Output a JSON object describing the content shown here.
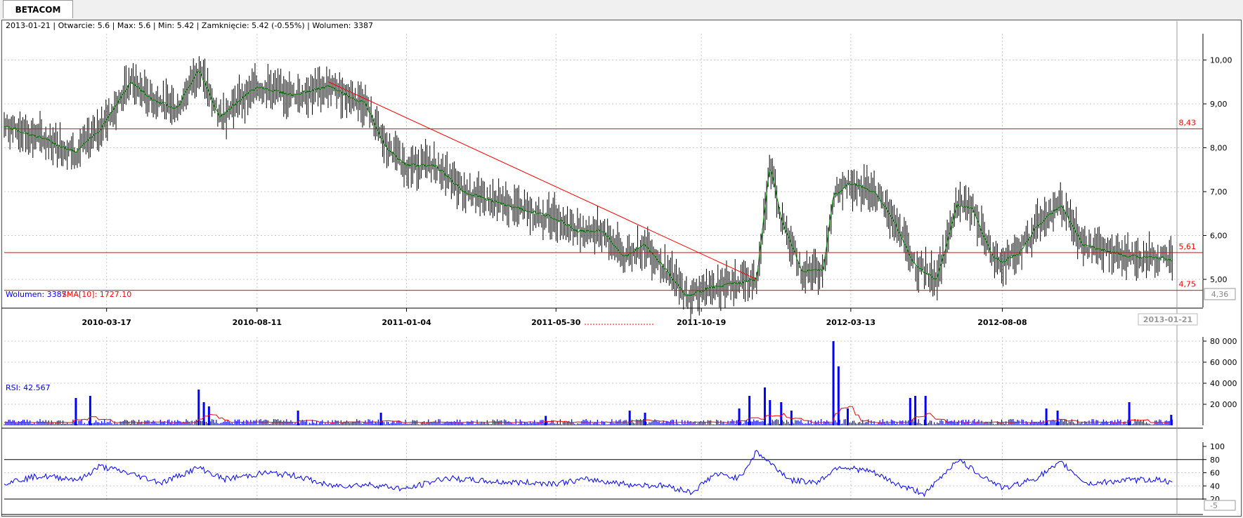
{
  "window": {
    "tab_label": "BETACOM"
  },
  "info": {
    "ohlc": "2013-01-21 | Otwarcie: 5.6 | Max: 5.6 | Min: 5.42 | Zamknięcie: 5.42 (-0.55%)  | Wolumen: 3387",
    "volume_label": "Wolumen: 3387",
    "sma_label": "SMA[10]: 1727.10",
    "rsi_label": "RSI: 42.567"
  },
  "colors": {
    "price_bar": "#000000",
    "sma_price": "#008000",
    "level": "#ff0000",
    "volume": "#0000ff",
    "rsi": "#0000ff",
    "grid": "#c8c8c8"
  },
  "chart_data": [
    {
      "type": "bar",
      "panel": "price",
      "y_ticks": [
        "10,00",
        "9,00",
        "8,00",
        "7,00",
        "6,00",
        "5,00"
      ],
      "ylim": [
        4.36,
        10.6
      ],
      "x_ticks": [
        "2010-03-17",
        "2010-08-11",
        "2011-01-04",
        "2011-05-30",
        "2011-10-19",
        "2012-03-13",
        "2012-08-08"
      ],
      "cursor_date": "2013-01-21",
      "cursor_price": "4,36",
      "levels": [
        {
          "value": 8.43,
          "label": "8,43"
        },
        {
          "value": 5.61,
          "label": "5,61"
        },
        {
          "value": 4.75,
          "label": "4,75"
        }
      ],
      "trendline": [
        {
          "date": "2010-10-20",
          "price": 9.5
        },
        {
          "date": "2011-12-12",
          "price": 5.0
        }
      ],
      "price_path": [
        [
          "2009-12-07",
          8.5
        ],
        [
          "2010-01-15",
          8.2
        ],
        [
          "2010-02-15",
          7.9
        ],
        [
          "2010-03-10",
          8.4
        ],
        [
          "2010-04-10",
          9.5
        ],
        [
          "2010-05-01",
          9.1
        ],
        [
          "2010-05-25",
          8.9
        ],
        [
          "2010-06-15",
          9.8
        ],
        [
          "2010-07-05",
          8.7
        ],
        [
          "2010-08-11",
          9.4
        ],
        [
          "2010-09-15",
          9.2
        ],
        [
          "2010-10-20",
          9.4
        ],
        [
          "2010-11-25",
          9.0
        ],
        [
          "2010-12-15",
          8.0
        ],
        [
          "2011-01-04",
          7.6
        ],
        [
          "2011-02-01",
          7.6
        ],
        [
          "2011-03-01",
          7.0
        ],
        [
          "2011-04-10",
          6.7
        ],
        [
          "2011-05-30",
          6.4
        ],
        [
          "2011-06-20",
          6.1
        ],
        [
          "2011-07-15",
          6.1
        ],
        [
          "2011-08-05",
          5.5
        ],
        [
          "2011-08-25",
          5.8
        ],
        [
          "2011-09-15",
          5.2
        ],
        [
          "2011-10-05",
          4.6
        ],
        [
          "2011-10-25",
          4.8
        ],
        [
          "2011-11-20",
          4.9
        ],
        [
          "2011-12-12",
          5.0
        ],
        [
          "2011-12-25",
          7.6
        ],
        [
          "2012-01-05",
          6.4
        ],
        [
          "2012-01-25",
          5.2
        ],
        [
          "2012-02-15",
          5.2
        ],
        [
          "2012-02-25",
          6.9
        ],
        [
          "2012-03-13",
          7.2
        ],
        [
          "2012-04-05",
          7.0
        ],
        [
          "2012-04-25",
          6.3
        ],
        [
          "2012-05-15",
          5.3
        ],
        [
          "2012-06-05",
          5.0
        ],
        [
          "2012-06-25",
          6.7
        ],
        [
          "2012-07-10",
          6.6
        ],
        [
          "2012-07-30",
          5.5
        ],
        [
          "2012-08-08",
          5.4
        ],
        [
          "2012-08-25",
          5.6
        ],
        [
          "2012-09-10",
          6.2
        ],
        [
          "2012-10-05",
          6.7
        ],
        [
          "2012-10-25",
          5.8
        ],
        [
          "2012-11-25",
          5.6
        ],
        [
          "2012-12-20",
          5.5
        ],
        [
          "2013-01-10",
          5.5
        ],
        [
          "2013-01-21",
          5.42
        ]
      ]
    },
    {
      "type": "bar",
      "panel": "volume",
      "series": [
        {
          "name": "Wolumen"
        },
        {
          "name": "SMA[10]"
        }
      ],
      "y_ticks": [
        "80 000",
        "60 000",
        "40 000",
        "20 000"
      ],
      "ylim": [
        0,
        80000
      ],
      "spikes": [
        [
          "2010-02-15",
          26000
        ],
        [
          "2010-03-01",
          28000
        ],
        [
          "2010-06-15",
          34000
        ],
        [
          "2010-06-20",
          22000
        ],
        [
          "2010-06-25",
          18000
        ],
        [
          "2010-09-20",
          14000
        ],
        [
          "2010-12-10",
          12000
        ],
        [
          "2011-05-20",
          9000
        ],
        [
          "2011-08-10",
          14000
        ],
        [
          "2011-08-25",
          12000
        ],
        [
          "2011-11-25",
          16000
        ],
        [
          "2011-12-05",
          28000
        ],
        [
          "2011-12-20",
          36000
        ],
        [
          "2011-12-25",
          24000
        ],
        [
          "2012-01-05",
          22000
        ],
        [
          "2012-01-15",
          14000
        ],
        [
          "2012-02-25",
          80000
        ],
        [
          "2012-03-01",
          56000
        ],
        [
          "2012-03-10",
          16000
        ],
        [
          "2012-05-10",
          26000
        ],
        [
          "2012-05-15",
          28000
        ],
        [
          "2012-05-25",
          28000
        ],
        [
          "2012-09-20",
          16000
        ],
        [
          "2012-10-01",
          14000
        ],
        [
          "2012-12-10",
          22000
        ],
        [
          "2013-01-20",
          10000
        ]
      ]
    },
    {
      "type": "line",
      "panel": "rsi",
      "series": [
        {
          "name": "RSI"
        }
      ],
      "y_ticks": [
        "100",
        "80",
        "60",
        "40",
        "20"
      ],
      "ylim": [
        20,
        100
      ],
      "levels": [
        80,
        20
      ],
      "bottom_label": "-5",
      "points": [
        [
          "2009-12-07",
          45
        ],
        [
          "2010-01-10",
          55
        ],
        [
          "2010-02-20",
          50
        ],
        [
          "2010-03-10",
          70
        ],
        [
          "2010-04-01",
          62
        ],
        [
          "2010-05-10",
          45
        ],
        [
          "2010-06-15",
          68
        ],
        [
          "2010-07-10",
          50
        ],
        [
          "2010-08-20",
          60
        ],
        [
          "2010-09-20",
          55
        ],
        [
          "2010-10-20",
          40
        ],
        [
          "2010-12-01",
          42
        ],
        [
          "2011-01-04",
          35
        ],
        [
          "2011-02-10",
          52
        ],
        [
          "2011-04-01",
          46
        ],
        [
          "2011-05-30",
          44
        ],
        [
          "2011-07-01",
          50
        ],
        [
          "2011-08-10",
          42
        ],
        [
          "2011-09-15",
          40
        ],
        [
          "2011-10-10",
          30
        ],
        [
          "2011-11-01",
          58
        ],
        [
          "2011-11-25",
          52
        ],
        [
          "2011-12-12",
          92
        ],
        [
          "2011-12-25",
          75
        ],
        [
          "2012-01-15",
          48
        ],
        [
          "2012-02-10",
          46
        ],
        [
          "2012-03-01",
          70
        ],
        [
          "2012-04-01",
          62
        ],
        [
          "2012-05-01",
          40
        ],
        [
          "2012-05-25",
          28
        ],
        [
          "2012-06-25",
          80
        ],
        [
          "2012-07-20",
          55
        ],
        [
          "2012-08-10",
          36
        ],
        [
          "2012-09-10",
          52
        ],
        [
          "2012-10-05",
          75
        ],
        [
          "2012-10-30",
          43
        ],
        [
          "2012-12-01",
          48
        ],
        [
          "2013-01-10",
          50
        ],
        [
          "2013-01-21",
          42
        ]
      ]
    }
  ]
}
